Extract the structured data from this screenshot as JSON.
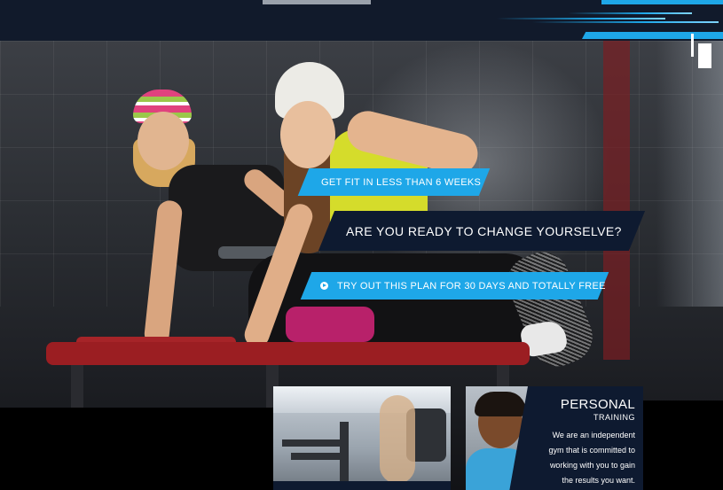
{
  "hero": {
    "slide_tagline": "GET FIT IN LESS THAN 6 WEEKS",
    "slide_headline": "ARE YOU READY TO CHANGE YOURSELVE?",
    "slide_cta": "TRY OUT THIS PLAN FOR 30 DAYS AND TOTALLY FREE",
    "cta_icon": "play-circle-icon"
  },
  "cards": {
    "personal_training": {
      "title": "PERSONAL",
      "subtitle": "TRAINING",
      "lines": [
        "We are an independent",
        "gym that is committed to",
        "working with you to gain",
        "the results you want."
      ]
    }
  },
  "colors": {
    "accent_blue": "#1ea7e8",
    "navy": "#0e1a30",
    "header": "#111a2b"
  }
}
